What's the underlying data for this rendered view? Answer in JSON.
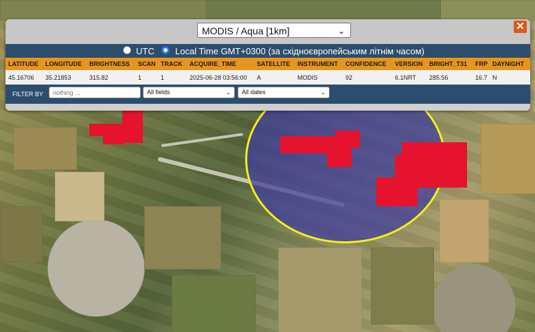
{
  "source_select": {
    "value": "MODIS / Aqua [1km]"
  },
  "close_label": "✕",
  "time_options": {
    "utc": "UTC",
    "local": "Local Time GMT+0300 (за східноєвропейським літнім часом)",
    "selected": "local"
  },
  "table": {
    "headers": [
      "LATITUDE",
      "LONGITUDE",
      "BRIGHTNESS",
      "SCAN",
      "TRACK",
      "ACQUIRE_TIME",
      "SATELLITE",
      "INSTRUMENT",
      "CONFIDENCE",
      "VERSION",
      "BRIGHT_T31",
      "FRP",
      "DAYNIGHT"
    ],
    "rows": [
      [
        "45.16706",
        "35.21853",
        "315.82",
        "1",
        "1",
        "2025-06-28 03:56:00",
        "A",
        "MODIS",
        "92",
        "6.1NRT",
        "285.56",
        "16.7",
        "N"
      ]
    ]
  },
  "filter": {
    "label": "FILTER BY",
    "input_placeholder": "nothing ...",
    "fields_select": "All fields",
    "dates_select": "All dates"
  },
  "colors": {
    "fire": "#e5132e",
    "circle_border": "#f5ee1c",
    "header": "#e8951f",
    "bar": "#2c4d6d",
    "close": "#dd5a1a"
  }
}
